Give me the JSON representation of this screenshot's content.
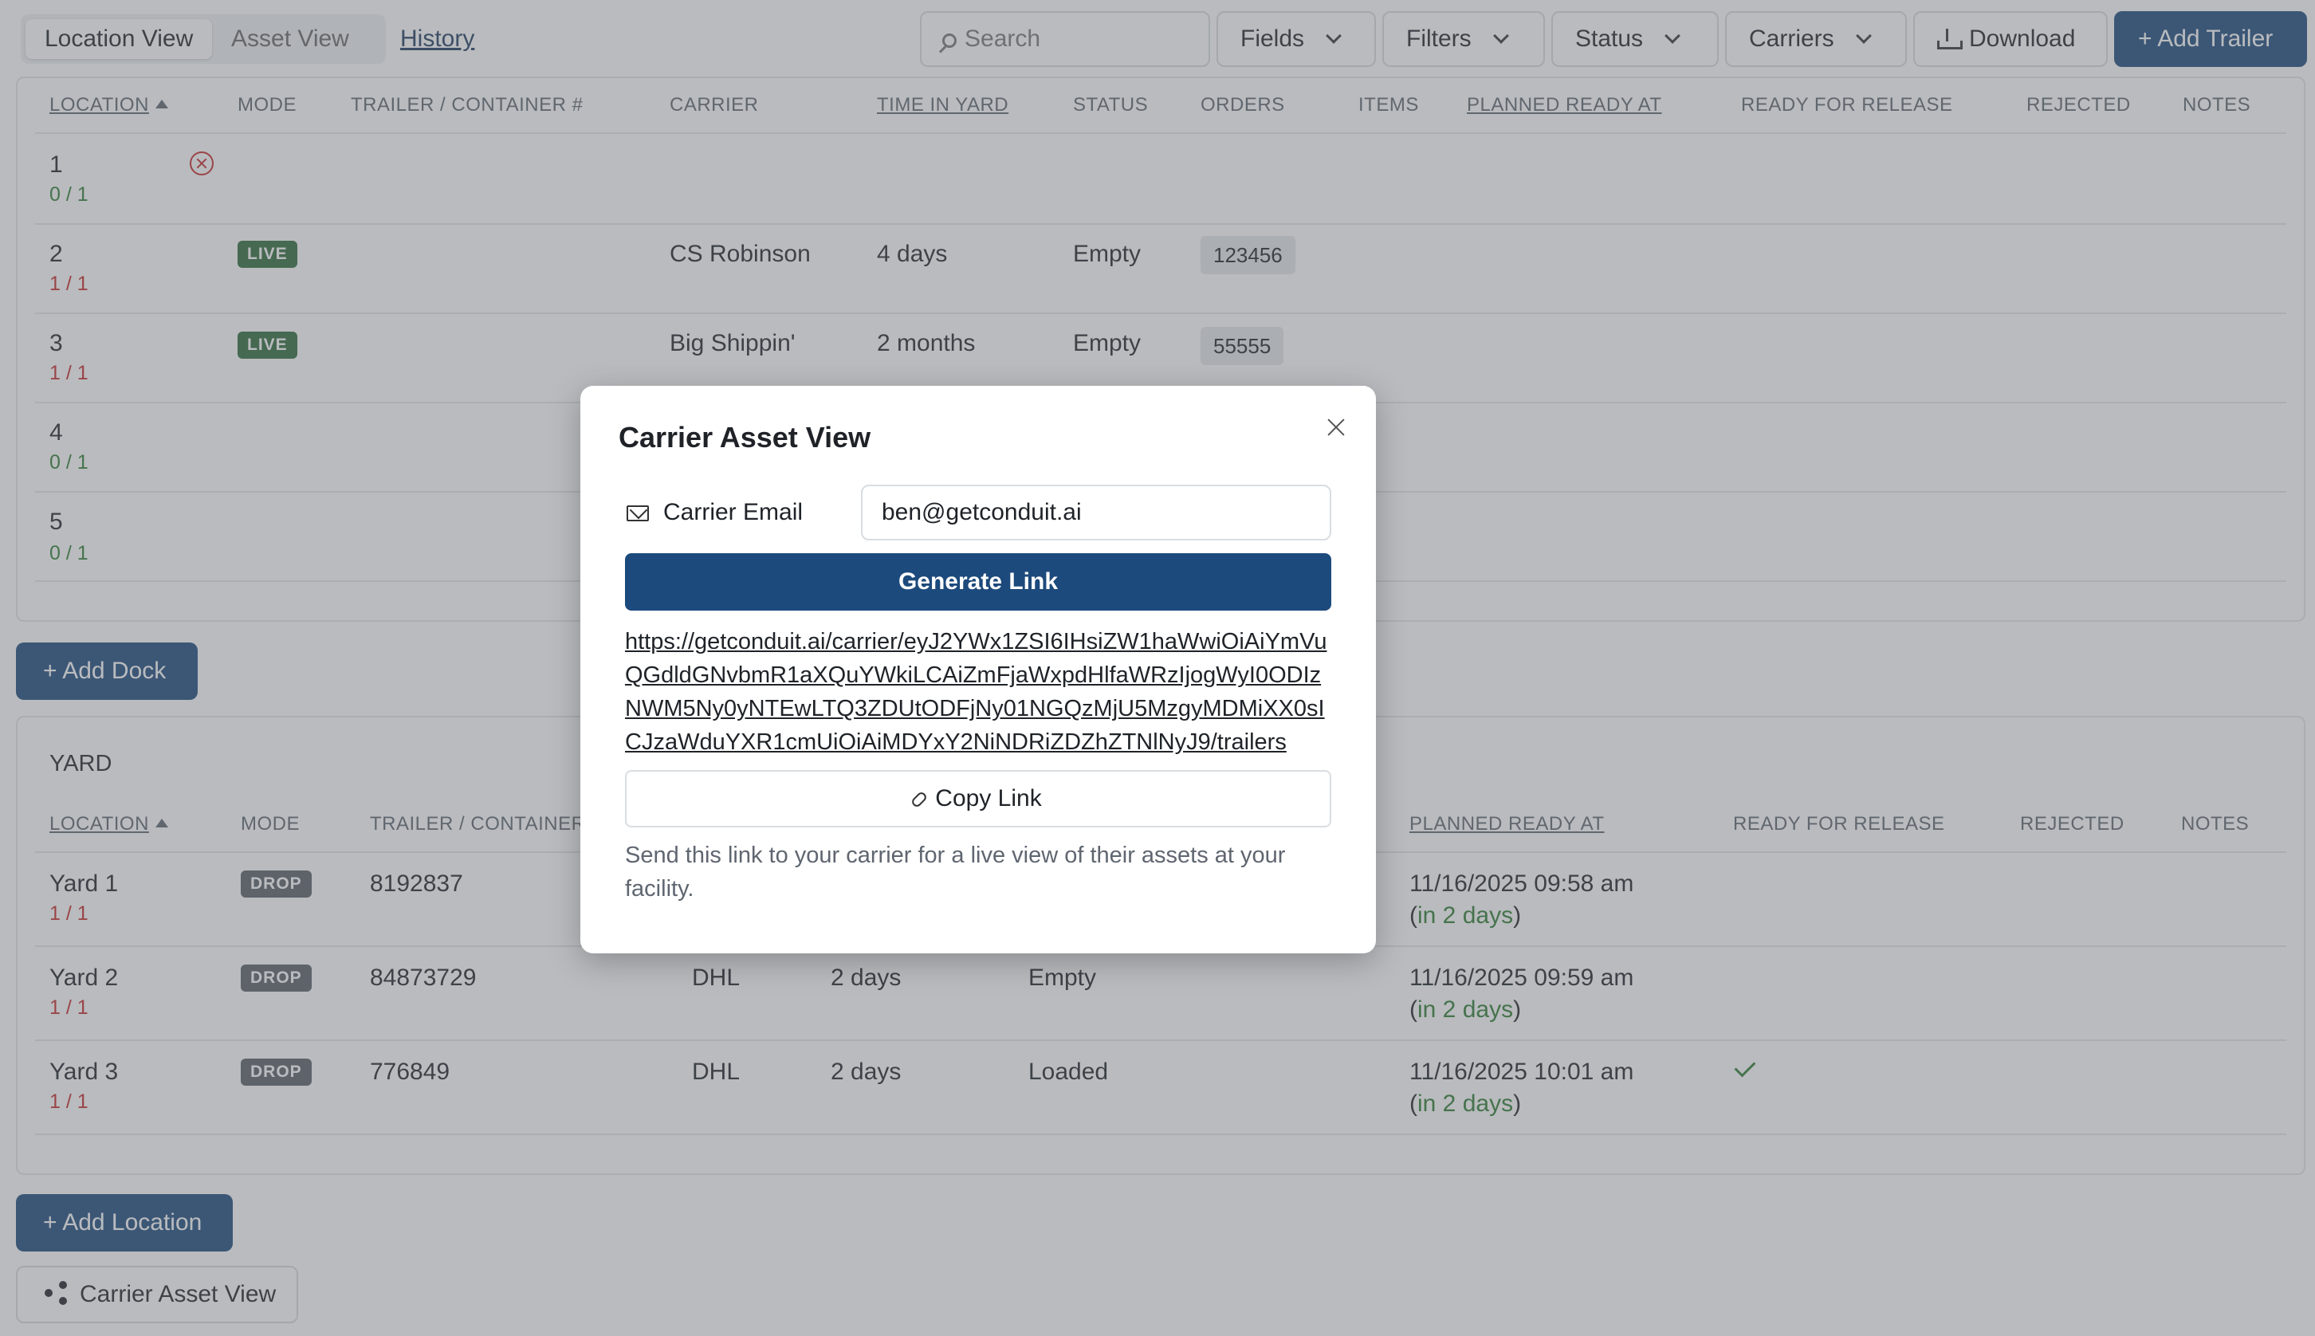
{
  "toolbar": {
    "view_tabs": [
      "Location View",
      "Asset View"
    ],
    "history_label": "History",
    "search_placeholder": "Search",
    "fields_label": "Fields",
    "filters_label": "Filters",
    "status_label": "Status",
    "carriers_label": "Carriers",
    "download_label": "Download",
    "add_trailer_label": "+ Add Trailer"
  },
  "docks": {
    "columns": [
      "LOCATION",
      "MODE",
      "TRAILER / CONTAINER #",
      "CARRIER",
      "TIME IN YARD",
      "STATUS",
      "ORDERS",
      "ITEMS",
      "PLANNED READY AT",
      "READY FOR RELEASE",
      "REJECTED",
      "NOTES"
    ],
    "rows": [
      {
        "location": "1",
        "capacity": "0 / 1",
        "mode": "",
        "carrier": "",
        "time": "",
        "status": "",
        "order": ""
      },
      {
        "location": "2",
        "capacity": "1 / 1",
        "mode": "LIVE",
        "carrier": "CS Robinson",
        "time": "4 days",
        "status": "Empty",
        "order": "123456"
      },
      {
        "location": "3",
        "capacity": "1 / 1",
        "mode": "LIVE",
        "carrier": "Big Shippin'",
        "time": "2 months",
        "status": "Empty",
        "order": "55555"
      },
      {
        "location": "4",
        "capacity": "0 / 1"
      },
      {
        "location": "5",
        "capacity": "0 / 1"
      }
    ],
    "add_label": "+ Add Dock"
  },
  "yard": {
    "title": "YARD",
    "columns": [
      "LOCATION",
      "MODE",
      "TRAILER / CONTAINER #",
      "PLANNED READY AT",
      "READY FOR RELEASE",
      "REJECTED",
      "NOTES"
    ],
    "rows": [
      {
        "location": "Yard 1",
        "capacity": "1 / 1",
        "mode": "DROP",
        "trailer": "8192837",
        "carrier": "",
        "time": "",
        "status": "",
        "planned": "11/16/2025 09:58 am",
        "relative": "in 2 days"
      },
      {
        "location": "Yard 2",
        "capacity": "1 / 1",
        "mode": "DROP",
        "trailer": "84873729",
        "carrier": "DHL",
        "time": "2 days",
        "status": "Empty",
        "planned": "11/16/2025 09:59 am",
        "relative": "in 2 days"
      },
      {
        "location": "Yard 3",
        "capacity": "1 / 1",
        "mode": "DROP",
        "trailer": "776849",
        "carrier": "DHL",
        "time": "2 days",
        "status": "Loaded",
        "planned": "11/16/2025 10:01 am",
        "relative": "in 2 days"
      }
    ],
    "add_label": "+ Add Location"
  },
  "carrier_view_label": "Carrier Asset View",
  "modal": {
    "title": "Carrier Asset View",
    "email_label": "Carrier Email",
    "email_value": "ben@getconduit.ai",
    "generate_label": "Generate Link",
    "link": "https://getconduit.ai/carrier/eyJ2YWx1ZSI6IHsiZW1haWwiOiAiYmVuQGdldGNvbmR1aXQuYWkiLCAiZmFjaWxpdHlfaWRzIjogWyI0ODIzNWM5Ny0yNTEwLTQ3ZDUtODFjNy01NGQzMjU5MzgyMDMiXX0sICJzaWduYXR1cmUiOiAiMDYxY2NiNDRiZDZhZTNlNyJ9/trailers",
    "copy_label": "Copy Link",
    "help_text": "Send this link to your carrier for a live view of their assets at your facility."
  },
  "colors": {
    "primary": "#1d4a7c",
    "live": "#2e6b3a",
    "drop": "#5a5f66",
    "ok": "#2e7d32",
    "full": "#c62828"
  },
  "icons": [
    "search-icon",
    "chevron-down-icon",
    "download-icon",
    "x-circle-icon",
    "check-icon",
    "close-icon",
    "mail-icon",
    "link-icon",
    "share-icon"
  ]
}
